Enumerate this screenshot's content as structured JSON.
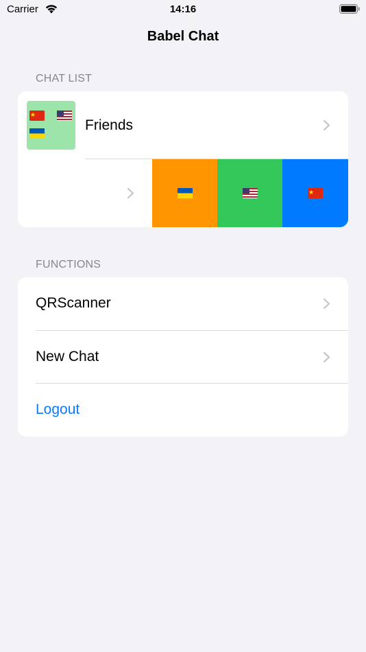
{
  "status_bar": {
    "carrier": "Carrier",
    "time": "14:16"
  },
  "nav": {
    "title": "Babel Chat"
  },
  "chat_list": {
    "header": "CHAT LIST",
    "items": [
      {
        "name": "Friends",
        "avatar_color": "#9de4aa",
        "flags": [
          "flag-china-icon",
          "flag-usa-icon",
          "flag-ukraine-icon"
        ]
      }
    ],
    "swipe_actions": [
      {
        "icon": "flag-ukraine-icon",
        "color": "#ff9500"
      },
      {
        "icon": "flag-usa-icon",
        "color": "#34c759"
      },
      {
        "icon": "flag-china-icon",
        "color": "#007aff"
      }
    ]
  },
  "functions": {
    "header": "FUNCTIONS",
    "items": [
      {
        "label": "QRScanner"
      },
      {
        "label": "New Chat"
      },
      {
        "label": "Logout",
        "color": "#0a7aff"
      }
    ]
  },
  "colors": {
    "background": "#f2f2f7",
    "accent": "#0a7aff"
  }
}
